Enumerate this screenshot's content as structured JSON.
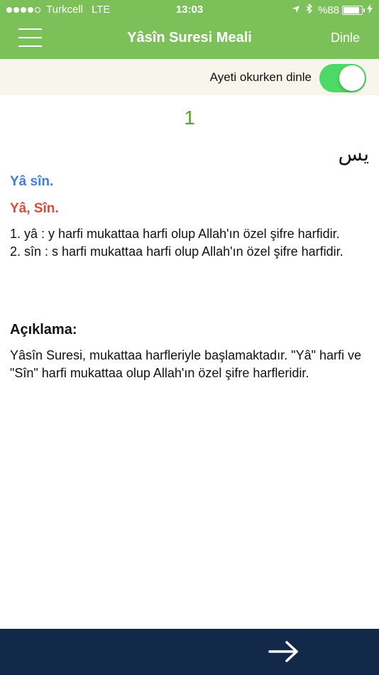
{
  "status_bar": {
    "carrier": "Turkcell",
    "network": "LTE",
    "time": "13:03",
    "battery": "%88"
  },
  "nav": {
    "title": "Yâsîn Suresi Meali",
    "listen_label": "Dinle"
  },
  "options": {
    "listen_while_reading_label": "Ayeti okurken dinle",
    "listen_while_reading_enabled": true
  },
  "verse": {
    "number": "1",
    "arabic": "يس",
    "transliteration": "Yâ sîn.",
    "meaning": "Yâ, Sîn.",
    "word_notes": [
      "1. yâ  : y harfi mukattaa harfi olup Allah'ın özel şifre harfidir.",
      "2. sîn : s harfi mukattaa harfi olup Allah'ın özel şifre harfidir."
    ]
  },
  "explanation": {
    "heading": "Açıklama:",
    "text": "Yâsîn Suresi, mukattaa harfleriyle başlamaktadır. \"Yâ\" harfi ve \"Sîn\" harfi mukattaa olup Allah'ın özel şifre harfleridir."
  },
  "icons": {
    "menu": "hamburger-menu-icon",
    "next": "arrow-right-icon"
  },
  "colors": {
    "header": "#7cc05a",
    "verse_number": "#5a9e34",
    "transliteration": "#3f7dd8",
    "meaning": "#d94a3e",
    "bottom_bar": "#13294a",
    "toggle_on": "#4cd964"
  }
}
